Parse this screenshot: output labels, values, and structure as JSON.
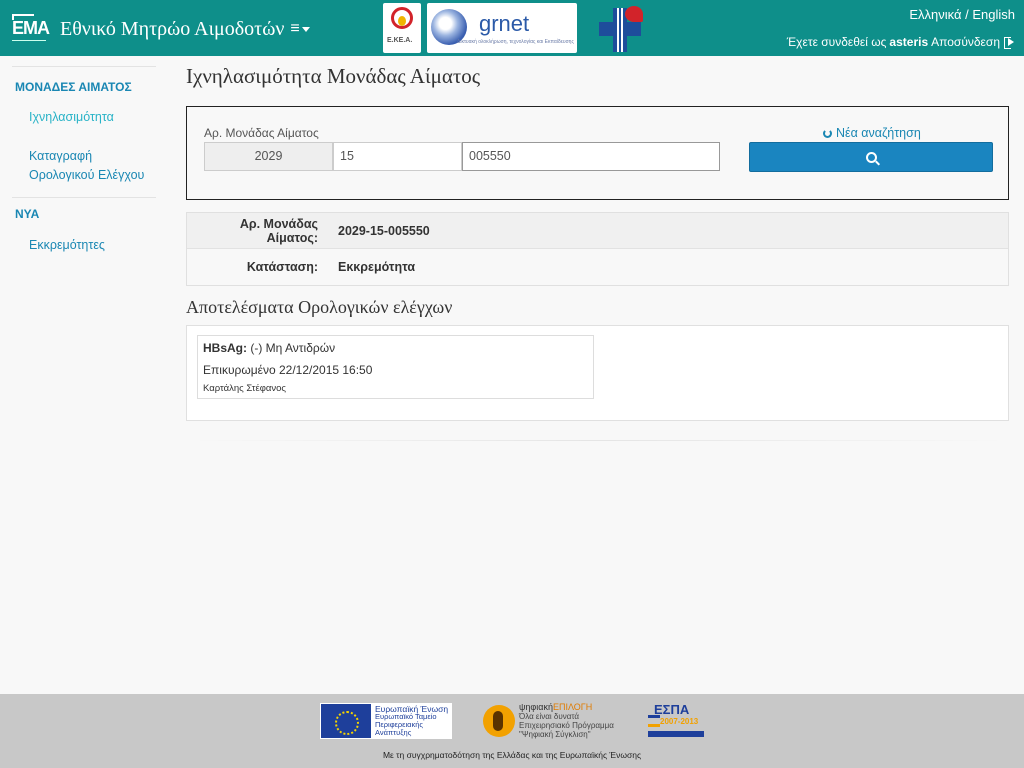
{
  "header": {
    "brand_logo_text": "EMA",
    "title": "Εθνικό Μητρώο Αιμοδοτών",
    "menu_toggle": "≡",
    "partners": {
      "ekea_text": "Ε.ΚΕ.Α.",
      "grnet_text": "grnet",
      "grnet_sub": "Δικτυακή ολοκλήρωση, τεχνολογίας και Εκπαίδευσης"
    },
    "language": {
      "greek": "Ελληνικά",
      "separator": " / ",
      "english": "English"
    },
    "user": {
      "prefix": "Έχετε συνδεθεί ως",
      "username": "asteris",
      "logout": "Αποσύνδεση"
    }
  },
  "sidebar": {
    "sections": [
      {
        "title": "ΜΟΝΑΔΕΣ ΑΙΜΑΤΟΣ"
      },
      {
        "title": "ΝΥΑ"
      }
    ],
    "items": [
      {
        "label": "Ιχνηλασιμότητα"
      },
      {
        "label_line1": "Καταγραφή",
        "label_line2": "Ορολογικού Ελέγχου"
      },
      {
        "label": "Εκκρεμότητες"
      }
    ]
  },
  "main": {
    "page_title": "Ιχνηλασιμότητα Μονάδας Αίματος",
    "search": {
      "label": "Αρ. Μονάδας Αίματος",
      "year": "2029",
      "center": "15",
      "serial": "005550",
      "new_search": "Νέα αναζήτηση"
    },
    "info": [
      {
        "key": "Αρ. Μονάδας Αίματος:",
        "value": "2029-15-005550"
      },
      {
        "key": "Κατάσταση:",
        "value": "Εκκρεμότητα"
      }
    ],
    "results_title": "Αποτελέσματα Ορολογικών ελέγχων",
    "result": {
      "test": "HBsAg:",
      "value": "(-) Μη Αντιδρών",
      "validated": "Επικυρωμένο 22/12/2015 16:50",
      "person": "Καρτάλης Στέφανος"
    }
  },
  "footer": {
    "eu": {
      "line1": "Ευρωπαϊκή Ένωση",
      "line2": "Ευρωπαϊκό Ταμείο",
      "line3": "Περιφερειακής",
      "line4": "Ανάπτυξης"
    },
    "digital": {
      "line1a": "ψηφιακή",
      "line1b": "ΕΠΙΛΟΓΗ",
      "line2": "Όλα είναι δυνατά",
      "line3": "Επιχειρησιακό Πρόγραμμα",
      "line4": "\"Ψηφιακή Σύγκλιση\""
    },
    "espa": {
      "title": "ΕΣΠΑ",
      "years": "2007-2013"
    },
    "text": "Με τη συγχρηματοδότηση της Ελλάδας και της Ευρωπαϊκής Ένωσης"
  },
  "colors": {
    "header_bg": "#0e8f8a",
    "link": "#1a87b3",
    "search_button": "#1a85c0",
    "footer_bg": "#c8c8c8"
  }
}
